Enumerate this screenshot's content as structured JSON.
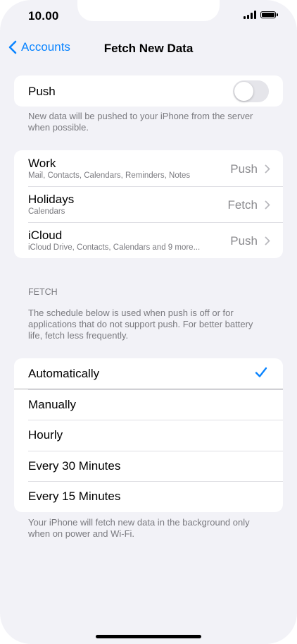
{
  "status": {
    "time": "10.00"
  },
  "nav": {
    "back_label": "Accounts",
    "title": "Fetch New Data"
  },
  "push": {
    "label": "Push",
    "on": false,
    "footer": "New data will be pushed to your iPhone from the server when possible."
  },
  "accounts": [
    {
      "name": "Work",
      "detail": "Mail, Contacts, Calendars, Reminders, Notes",
      "mode": "Push"
    },
    {
      "name": "Holidays",
      "detail": "Calendars",
      "mode": "Fetch"
    },
    {
      "name": "iCloud",
      "detail": "iCloud Drive, Contacts, Calendars and 9 more...",
      "mode": "Push"
    }
  ],
  "fetch": {
    "header": "FETCH",
    "description": "The schedule below is used when push is off or for applications that do not support push. For better battery life, fetch less frequently.",
    "options": [
      "Automatically",
      "Manually",
      "Hourly",
      "Every 30 Minutes",
      "Every 15 Minutes"
    ],
    "selected": "Automatically",
    "footer": "Your iPhone will fetch new data in the background only when on power and Wi-Fi."
  },
  "colors": {
    "accent": "#0a84ff",
    "background": "#f2f2f7"
  }
}
